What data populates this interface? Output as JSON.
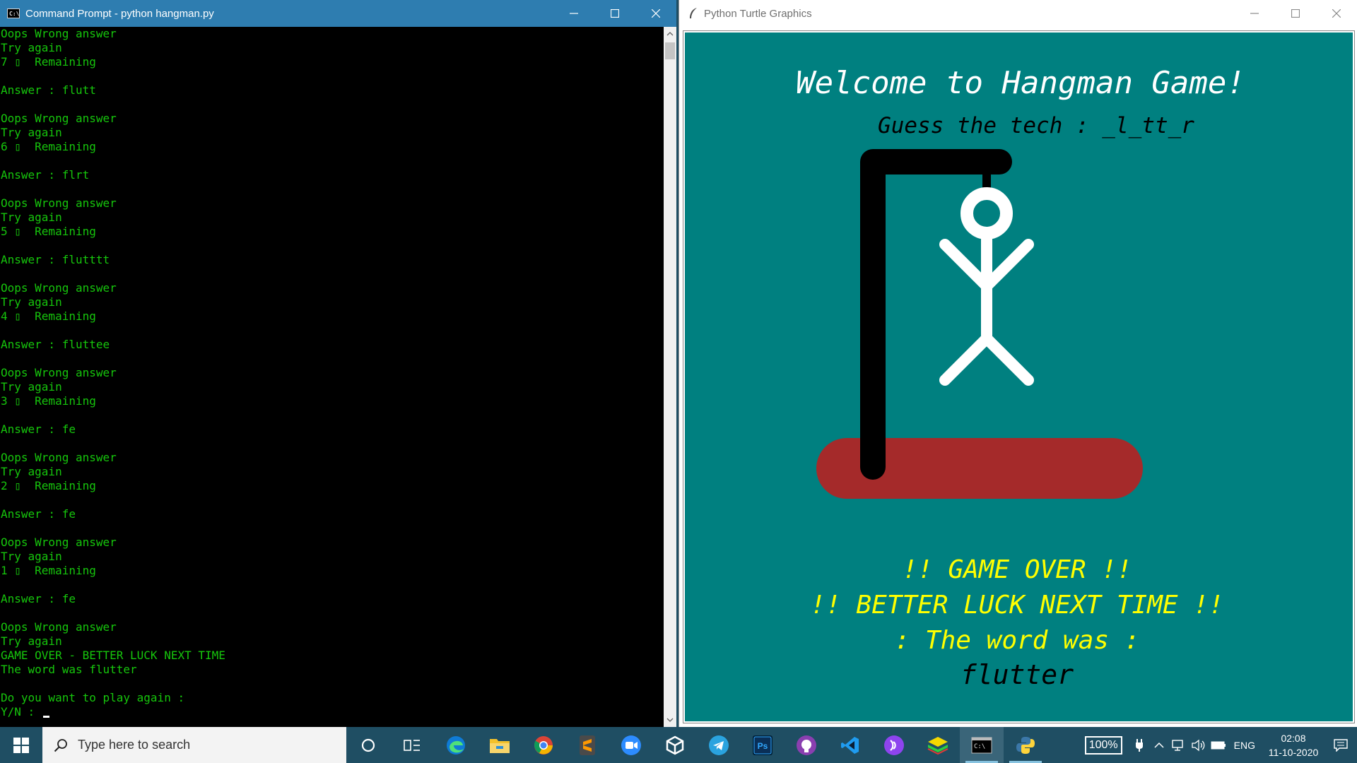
{
  "cmd": {
    "title": "Command Prompt - python  hangman.py",
    "icon_label": "C:\\",
    "console_text": "Oops Wrong answer\nTry again\n7 ▯  Remaining\n\nAnswer : flutt\n\nOops Wrong answer\nTry again\n6 ▯  Remaining\n\nAnswer : flrt\n\nOops Wrong answer\nTry again\n5 ▯  Remaining\n\nAnswer : flutttt\n\nOops Wrong answer\nTry again\n4 ▯  Remaining\n\nAnswer : fluttee\n\nOops Wrong answer\nTry again\n3 ▯  Remaining\n\nAnswer : fe\n\nOops Wrong answer\nTry again\n2 ▯  Remaining\n\nAnswer : fe\n\nOops Wrong answer\nTry again\n1 ▯  Remaining\n\nAnswer : fe\n\nOops Wrong answer\nTry again\nGAME OVER - BETTER LUCK NEXT TIME\nThe word was flutter\n\nDo you want to play again :\nY/N : ",
    "text_color": "#16c60c",
    "titlebar_color": "#2e7db0"
  },
  "turtle": {
    "title": "Python Turtle Graphics",
    "heading": "Welcome to Hangman Game!",
    "guess_line": "Guess the tech : _l_tt_r",
    "game_over": "!! GAME OVER !!",
    "better_luck": "!! BETTER LUCK NEXT TIME !!",
    "word_was": ": The word was :",
    "word": "flutter",
    "background_color": "#008080",
    "platform_color": "#a52a2a",
    "gallows_color": "#000000",
    "figure_color": "#ffffff",
    "message_color": "#ffff00"
  },
  "taskbar": {
    "search_placeholder": "Type here to search",
    "battery_percent": "100%",
    "language": "ENG",
    "time": "02:08",
    "date": "11-10-2020",
    "pinned": [
      "cortana-icon",
      "task-view-icon",
      "edge-icon",
      "file-explorer-icon",
      "chrome-icon",
      "sublime-text-icon",
      "zoom-icon",
      "unity-icon",
      "telegram-icon",
      "photoshop-icon",
      "github-desktop-icon",
      "vscode-icon",
      "podcast-icon",
      "bluestacks-icon",
      "command-prompt-icon",
      "python-icon"
    ]
  }
}
